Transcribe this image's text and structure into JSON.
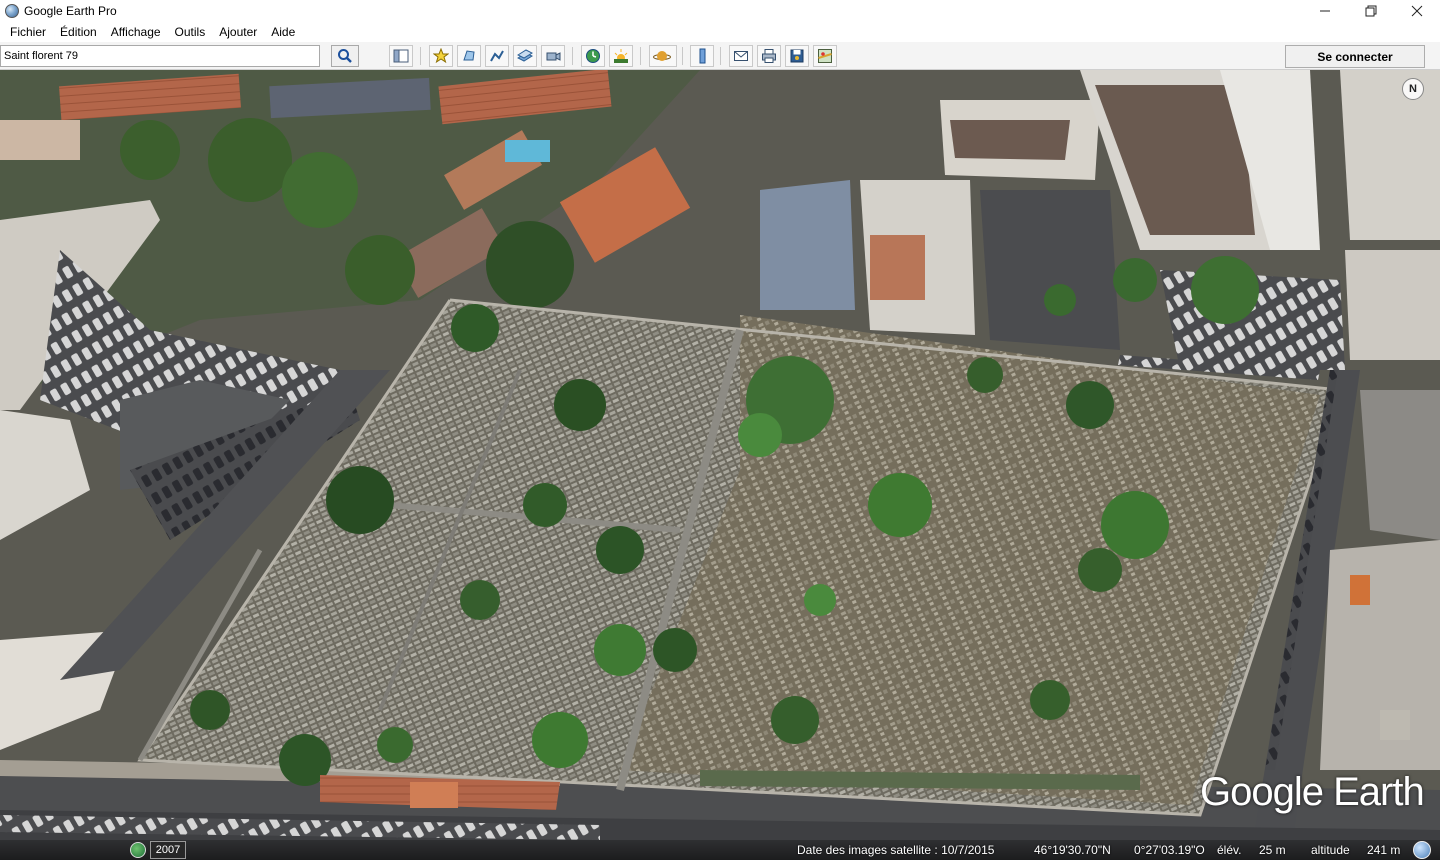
{
  "window": {
    "title": "Google Earth Pro",
    "minimize_icon": "minimize-icon",
    "maximize_icon": "restore-icon",
    "close_icon": "close-icon"
  },
  "menu": {
    "items": [
      {
        "label": "Fichier"
      },
      {
        "label": "Édition"
      },
      {
        "label": "Affichage"
      },
      {
        "label": "Outils"
      },
      {
        "label": "Ajouter"
      },
      {
        "label": "Aide"
      }
    ]
  },
  "toolbar": {
    "search_value": "Saint florent 79",
    "search_icon": "search-icon",
    "buttons": [
      {
        "name": "sidebar-toggle",
        "icon": "sidebar-icon"
      },
      {
        "name": "add-placemark",
        "icon": "placemark-icon"
      },
      {
        "name": "add-polygon",
        "icon": "polygon-icon"
      },
      {
        "name": "add-path",
        "icon": "path-icon"
      },
      {
        "name": "add-image-overlay",
        "icon": "image-overlay-icon"
      },
      {
        "name": "record-tour",
        "icon": "record-tour-icon"
      },
      {
        "name": "historical-imagery",
        "icon": "historical-imagery-icon"
      },
      {
        "name": "sunlight",
        "icon": "sunlight-icon"
      },
      {
        "name": "switch-planet",
        "icon": "planet-icon"
      },
      {
        "name": "ruler",
        "icon": "ruler-icon"
      },
      {
        "name": "email",
        "icon": "email-icon"
      },
      {
        "name": "print",
        "icon": "print-icon"
      },
      {
        "name": "save-image",
        "icon": "save-image-icon"
      },
      {
        "name": "view-in-maps",
        "icon": "maps-icon"
      }
    ],
    "connect_label": "Se connecter"
  },
  "map": {
    "compass_label": "N",
    "logo_text": "Google Earth",
    "colors": {
      "vegetation": "#3f6a2e",
      "cemetery_ground": "#6f6c5f",
      "roofs_terracotta": "#b5694a",
      "roads": "#4a4b4d"
    }
  },
  "status": {
    "history_year": "2007",
    "imagery_date": "Date des images satellite : 10/7/2015",
    "latitude": "46°19'30.70\"N",
    "longitude": "0°27'03.19\"O",
    "elevation_label": "élév.",
    "elevation_value": "25 m",
    "altitude_label": "altitude",
    "altitude_value": "241 m"
  }
}
